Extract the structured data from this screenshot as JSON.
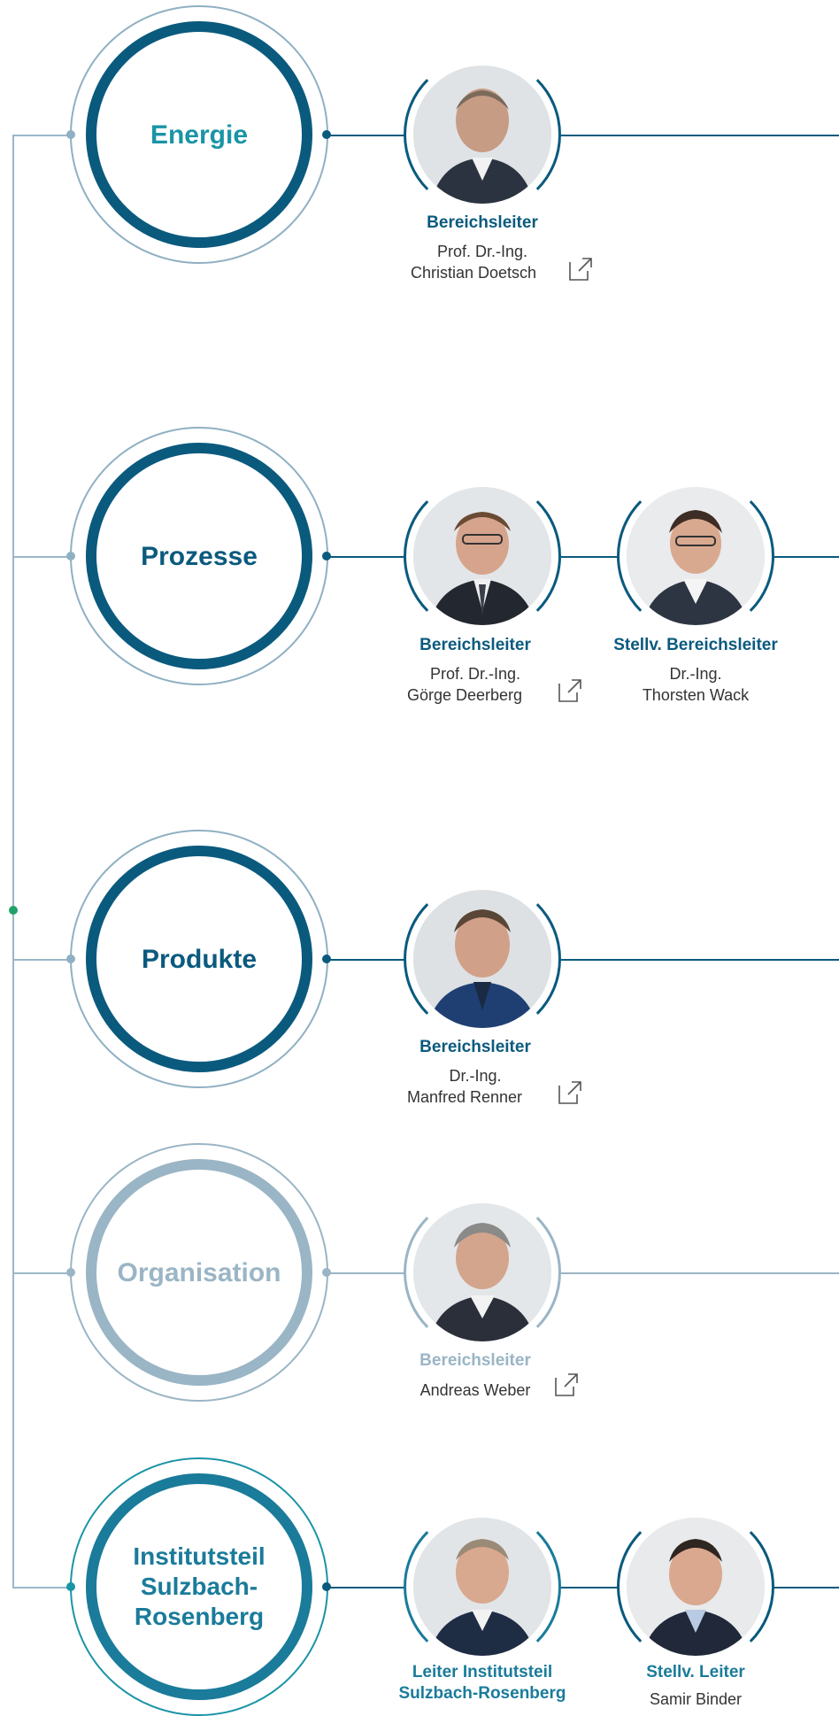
{
  "colors": {
    "dark_blue": "#0a5a7e",
    "teal": "#1a94a6",
    "muted": "#9ab5c5",
    "light_ring": "#8fb0c3",
    "line_grey": "#9bb7c8",
    "green_dot": "#21a36a"
  },
  "departments": [
    {
      "id": "energie",
      "label": "Energie",
      "state": "active-teal",
      "people": [
        {
          "role": "Bereichsleiter",
          "name_line1": "Prof. Dr.-Ing.",
          "name_line2": "Christian Doetsch",
          "has_link": true,
          "link_icon": "external-link-icon"
        }
      ]
    },
    {
      "id": "prozesse",
      "label": "Prozesse",
      "state": "active",
      "people": [
        {
          "role": "Bereichsleiter",
          "name_line1": "Prof. Dr.-Ing.",
          "name_line2": "Görge Deerberg",
          "has_link": true,
          "link_icon": "external-link-icon"
        },
        {
          "role": "Stellv. Bereichsleiter",
          "name_line1": "Dr.-Ing.",
          "name_line2": "Thorsten Wack",
          "has_link": false
        }
      ]
    },
    {
      "id": "produkte",
      "label": "Produkte",
      "state": "active",
      "people": [
        {
          "role": "Bereichsleiter",
          "name_line1": "Dr.-Ing.",
          "name_line2": "Manfred Renner",
          "has_link": true,
          "link_icon": "external-link-icon"
        }
      ]
    },
    {
      "id": "organisation",
      "label": "Organisation",
      "state": "muted",
      "people": [
        {
          "role": "Bereichsleiter",
          "name_line1": "Andreas Weber",
          "name_line2": "",
          "has_link": true,
          "link_icon": "external-link-icon"
        }
      ]
    },
    {
      "id": "sulzbach",
      "label_lines": [
        "Institutsteil",
        "Sulzbach-",
        "Rosenberg"
      ],
      "state": "active-teal",
      "people": [
        {
          "role_lines": [
            "Leiter Institutsteil",
            "Sulzbach-Rosenberg"
          ],
          "has_link": false
        },
        {
          "role": "Stellv. Leiter",
          "name_line1": "Samir Binder",
          "has_link": false
        }
      ]
    }
  ]
}
